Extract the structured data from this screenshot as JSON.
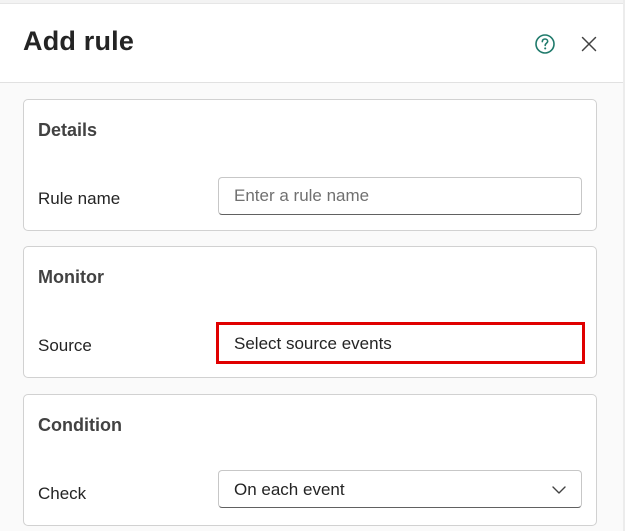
{
  "dialog": {
    "title": "Add rule",
    "help_icon": "help-circle-icon",
    "close_icon": "close-icon"
  },
  "sections": {
    "details": {
      "title": "Details",
      "rule_name_label": "Rule name",
      "rule_name_value": "",
      "rule_name_placeholder": "Enter a rule name"
    },
    "monitor": {
      "title": "Monitor",
      "source_label": "Source",
      "source_value": "Select source events"
    },
    "condition": {
      "title": "Condition",
      "check_label": "Check",
      "check_value": "On each event",
      "check_icon": "chevron-down-icon"
    }
  },
  "colors": {
    "highlight": "#e00000",
    "help_icon": "#1f7a6b"
  }
}
